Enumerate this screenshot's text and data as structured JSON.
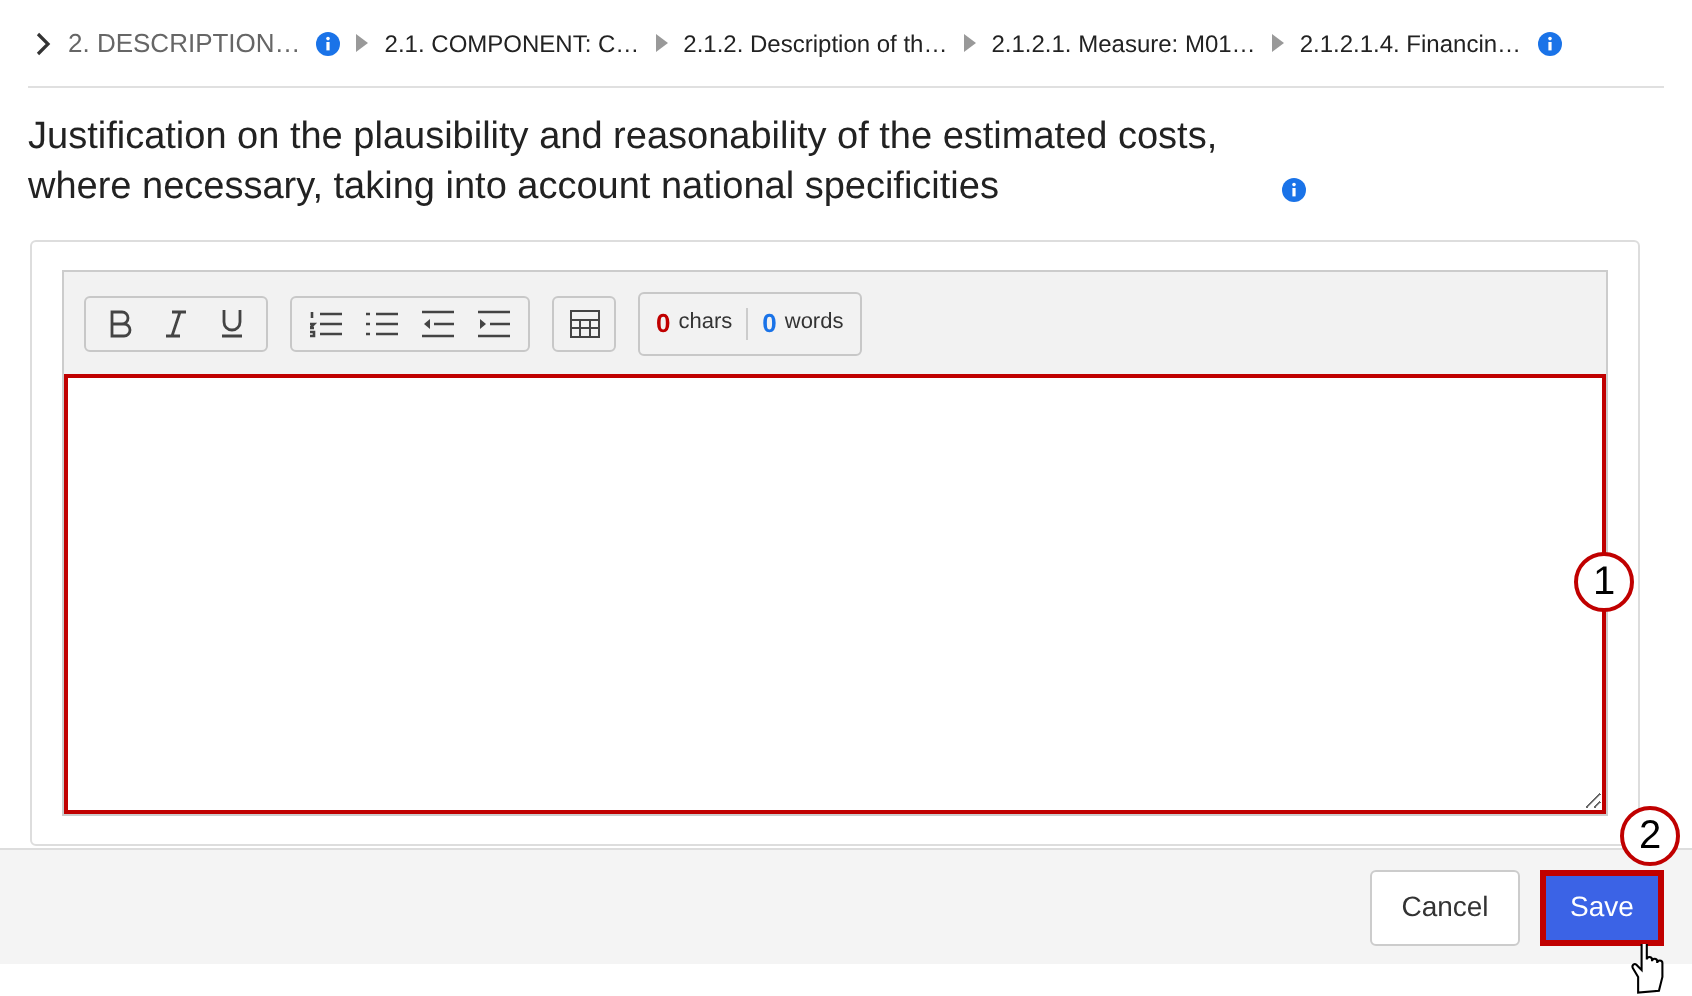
{
  "breadcrumb": [
    {
      "label": "2. DESCRIPTION…",
      "kind": "root",
      "info": true
    },
    {
      "label": "2.1. COMPONENT: C…",
      "kind": "item",
      "info": false
    },
    {
      "label": "2.1.2. Description of th…",
      "kind": "item",
      "info": false
    },
    {
      "label": "2.1.2.1. Measure: M01…",
      "kind": "item",
      "info": false
    },
    {
      "label": "2.1.2.1.4. Financin…",
      "kind": "item",
      "info": true
    }
  ],
  "heading": "Justification on the plausibility and reasonability of the estimated costs, where necessary, taking into account national specificities",
  "counter": {
    "chars": "0",
    "chars_label": "chars",
    "words": "0",
    "words_label": "words"
  },
  "callouts": [
    "1",
    "2"
  ],
  "buttons": {
    "cancel": "Cancel",
    "save": "Save"
  }
}
